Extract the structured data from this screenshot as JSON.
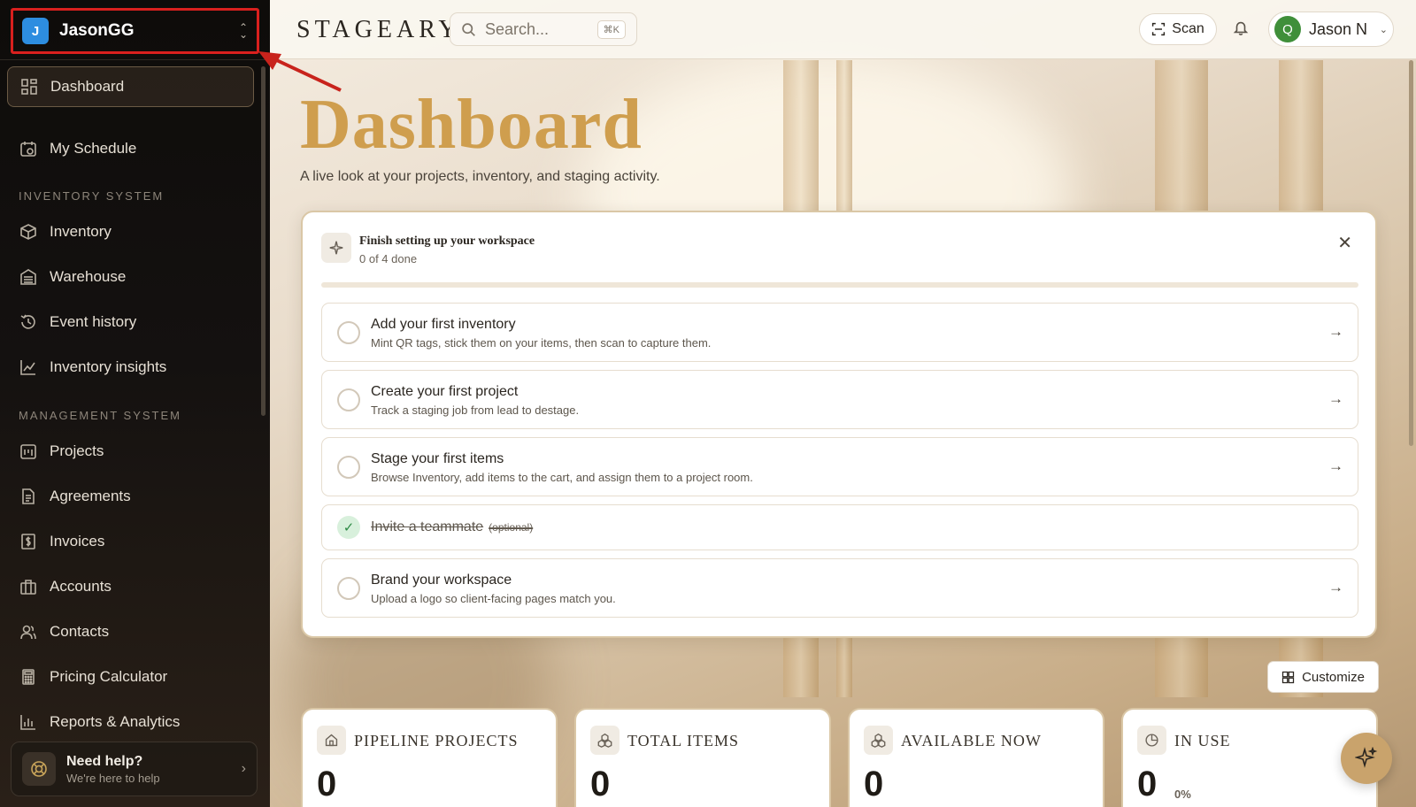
{
  "workspace": {
    "initial": "J",
    "name": "JasonGG"
  },
  "sidebar": {
    "items": [
      {
        "label": "Dashboard"
      },
      {
        "label": "My Schedule"
      }
    ],
    "inventory_section": "INVENTORY SYSTEM",
    "inventory_items": [
      {
        "label": "Inventory"
      },
      {
        "label": "Warehouse"
      },
      {
        "label": "Event history"
      },
      {
        "label": "Inventory insights"
      }
    ],
    "management_section": "MANAGEMENT SYSTEM",
    "management_items": [
      {
        "label": "Projects"
      },
      {
        "label": "Agreements"
      },
      {
        "label": "Invoices"
      },
      {
        "label": "Accounts"
      },
      {
        "label": "Contacts"
      },
      {
        "label": "Pricing Calculator"
      },
      {
        "label": "Reports & Analytics"
      }
    ],
    "help": {
      "title": "Need help?",
      "subtitle": "We're here to help"
    }
  },
  "header": {
    "logo": "STAGEARY",
    "search_placeholder": "Search...",
    "search_shortcut": "⌘K",
    "scan_label": "Scan",
    "user": {
      "initial": "Q",
      "name": "Jason N"
    }
  },
  "page": {
    "title": "Dashboard",
    "subtitle": "A live look at your projects, inventory, and staging activity."
  },
  "setup": {
    "title": "Finish setting up your workspace",
    "count": "0 of 4 done",
    "progress": 0,
    "tasks": [
      {
        "title": "Add your first inventory",
        "desc": "Mint QR tags, stick them on your items, then scan to capture them."
      },
      {
        "title": "Create your first project",
        "desc": "Track a staging job from lead to destage."
      },
      {
        "title": "Stage your first items",
        "desc": "Browse Inventory, add items to the cart, and assign them to a project room."
      },
      {
        "title": "Invite a teammate",
        "optional": "(optional)",
        "done": true
      },
      {
        "title": "Brand your workspace",
        "desc": "Upload a logo so client-facing pages match you."
      }
    ]
  },
  "customize_label": "Customize",
  "stats": [
    {
      "label": "PIPELINE PROJECTS",
      "value": "0"
    },
    {
      "label": "TOTAL ITEMS",
      "value": "0"
    },
    {
      "label": "AVAILABLE NOW",
      "value": "0"
    },
    {
      "label": "IN USE",
      "value": "0",
      "pct": "0%"
    }
  ],
  "colors": {
    "accent": "#cf9e4e",
    "highlight": "#d9201e",
    "workspace_avatar": "#2d8de0",
    "user_avatar": "#3f8f3a"
  }
}
